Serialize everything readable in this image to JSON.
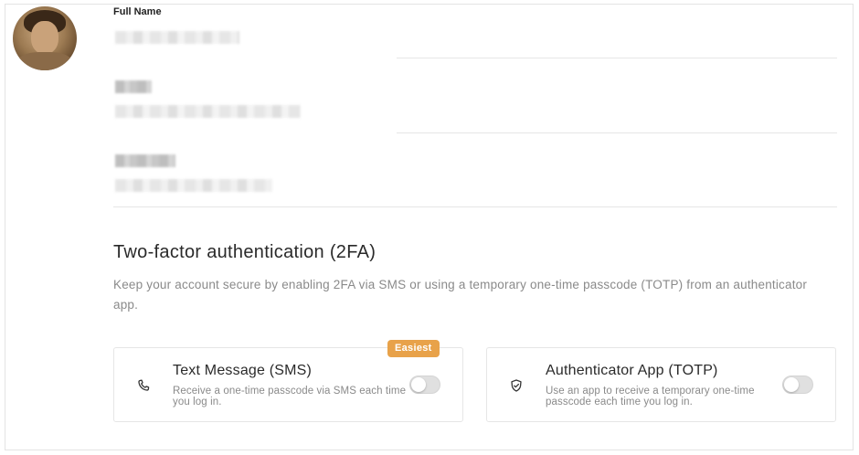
{
  "profile": {
    "full_name_label": "Full Name"
  },
  "two_factor": {
    "title": "Two-factor authentication (2FA)",
    "description": "Keep your account secure by enabling 2FA via SMS or using a temporary one-time passcode (TOTP) from an authenticator app.",
    "badge": "Easiest",
    "options": [
      {
        "title": "Text Message (SMS)",
        "description": "Receive a one-time passcode via SMS each time you log in.",
        "icon": "phone-icon",
        "enabled": false
      },
      {
        "title": "Authenticator App (TOTP)",
        "description": "Use an app to receive a temporary one-time passcode each time you log in.",
        "icon": "shield-icon",
        "enabled": false
      }
    ]
  },
  "colors": {
    "badge": "#e8a24a",
    "toggle_off": "#e0e0e0"
  }
}
